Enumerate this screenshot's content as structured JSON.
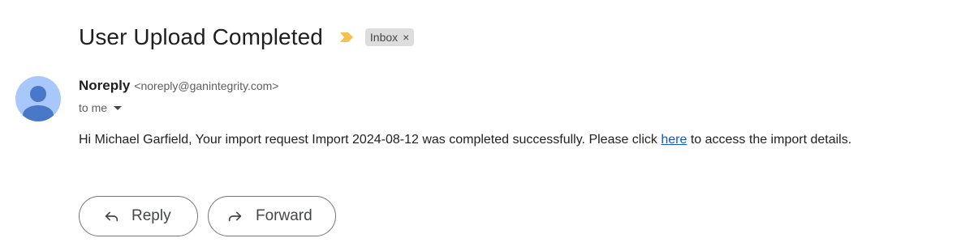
{
  "email": {
    "subject": "User Upload Completed",
    "label": "Inbox",
    "label_close": "×",
    "sender_name": "Noreply",
    "sender_email": "<noreply@ganintegrity.com>",
    "recipient": "to me",
    "body_before_link": "Hi Michael Garfield, Your import request Import 2024-08-12 was completed successfully. Please click ",
    "link_text": "here",
    "body_after_link": " to access the import details."
  },
  "actions": {
    "reply_label": "Reply",
    "forward_label": "Forward"
  },
  "colors": {
    "importance": "#f2c14e",
    "avatar_bg": "#a8c7fa",
    "avatar_fg": "#4a78c9",
    "link": "#1155cc"
  },
  "icons": {
    "importance": "importance-marker-icon",
    "avatar": "person-avatar-icon",
    "recipient_details": "chevron-down-icon",
    "reply": "reply-arrow-icon",
    "forward": "forward-arrow-icon"
  }
}
